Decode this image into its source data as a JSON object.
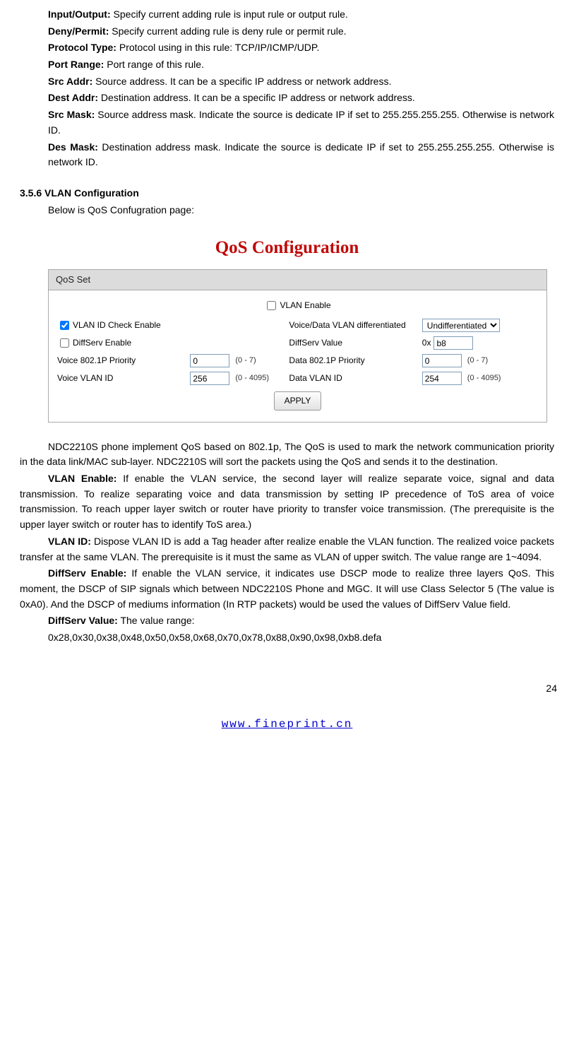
{
  "defs": {
    "input_output": {
      "label": "Input/Output:",
      "text": " Specify current adding rule is input rule or output rule."
    },
    "deny_permit": {
      "label": "Deny/Permit:",
      "text": " Specify current adding rule is deny rule or permit rule."
    },
    "protocol_type": {
      "label": "Protocol Type:",
      "text": " Protocol using in this rule: TCP/IP/ICMP/UDP."
    },
    "port_range": {
      "label": "Port Range:",
      "text": " Port range of this rule."
    },
    "src_addr": {
      "label": "Src Addr:",
      "text": " Source address. It can be a specific IP address or network address."
    },
    "dest_addr": {
      "label": "Dest Addr:",
      "text": " Destination address. It can be a specific IP address or network address."
    },
    "src_mask": {
      "label": "Src Mask:",
      "text": " Source address mask. Indicate the source is dedicate IP if set to 255.255.255.255. Otherwise is network ID."
    },
    "des_mask": {
      "label": "Des Mask:",
      "text": " Destination address mask. Indicate the source is dedicate IP if set to 255.255.255.255. Otherwise is network ID."
    }
  },
  "section_heading": "3.5.6 VLAN Configuration",
  "section_sub": "Below is QoS Confugration page:",
  "qos": {
    "title": "QoS Configuration",
    "header": "QoS Set",
    "vlan_enable_label": "VLAN Enable",
    "vlan_id_check_label": "VLAN ID Check Enable",
    "diffserv_enable_label": "DiffServ Enable",
    "voice_8021p_label": "Voice 802.1P Priority",
    "voice_vlan_id_label": "Voice VLAN ID",
    "voice_data_diff_label": "Voice/Data VLAN differentiated",
    "diffserv_value_label": "DiffServ Value",
    "data_8021p_label": "Data 802.1P Priority",
    "data_vlan_id_label": "Data VLAN ID",
    "select_value": "Undifferentiated",
    "hex_prefix": "0x",
    "diffserv_value_input": "b8",
    "voice_8021p_value": "0",
    "data_8021p_value": "0",
    "voice_vlan_id_value": "256",
    "data_vlan_id_value": "254",
    "hint_07": "(0 - 7)",
    "hint_4095": "(0 - 4095)",
    "apply_label": "APPLY"
  },
  "body_paragraphs": {
    "intro": "NDC2210S phone implement QoS based on 802.1p, The QoS is used to mark the network communication priority in the data link/MAC sub-layer. NDC2210S will sort the packets using the QoS and sends it to the destination.",
    "vlan_enable": {
      "label": "VLAN Enable:",
      "text": " If enable the VLAN service, the second layer will realize separate voice, signal and data transmission. To realize separating voice and data transmission by setting IP precedence of ToS area of voice transmission. To reach upper layer switch or router have priority to transfer voice transmission. (The prerequisite is the upper layer switch or router has to identify ToS area.)"
    },
    "vlan_id": {
      "label": "VLAN ID:",
      "text": " Dispose VLAN ID is add a Tag header after realize enable the VLAN function. The realized voice packets transfer at the same VLAN. The prerequisite is it must the same as VLAN of upper switch. The value range are 1~4094."
    },
    "diffserv_enable": {
      "label": "DiffServ Enable:",
      "text": " If enable the VLAN service, it indicates use DSCP mode to realize three layers QoS. This moment, the DSCP of SIP signals which between NDC2210S Phone and MGC. It will use Class Selector 5 (The value is 0xA0). And the DSCP of mediums information (In RTP packets) would be used the values of DiffServ Value field."
    },
    "diffserv_value": {
      "label": "DiffServ Value:",
      "text": " The value range:"
    },
    "diffserv_values_list": "0x28,0x30,0x38,0x48,0x50,0x58,0x68,0x70,0x78,0x88,0x90,0x98,0xb8.defa"
  },
  "page_number": "24",
  "footer_url": "www.fineprint.cn"
}
